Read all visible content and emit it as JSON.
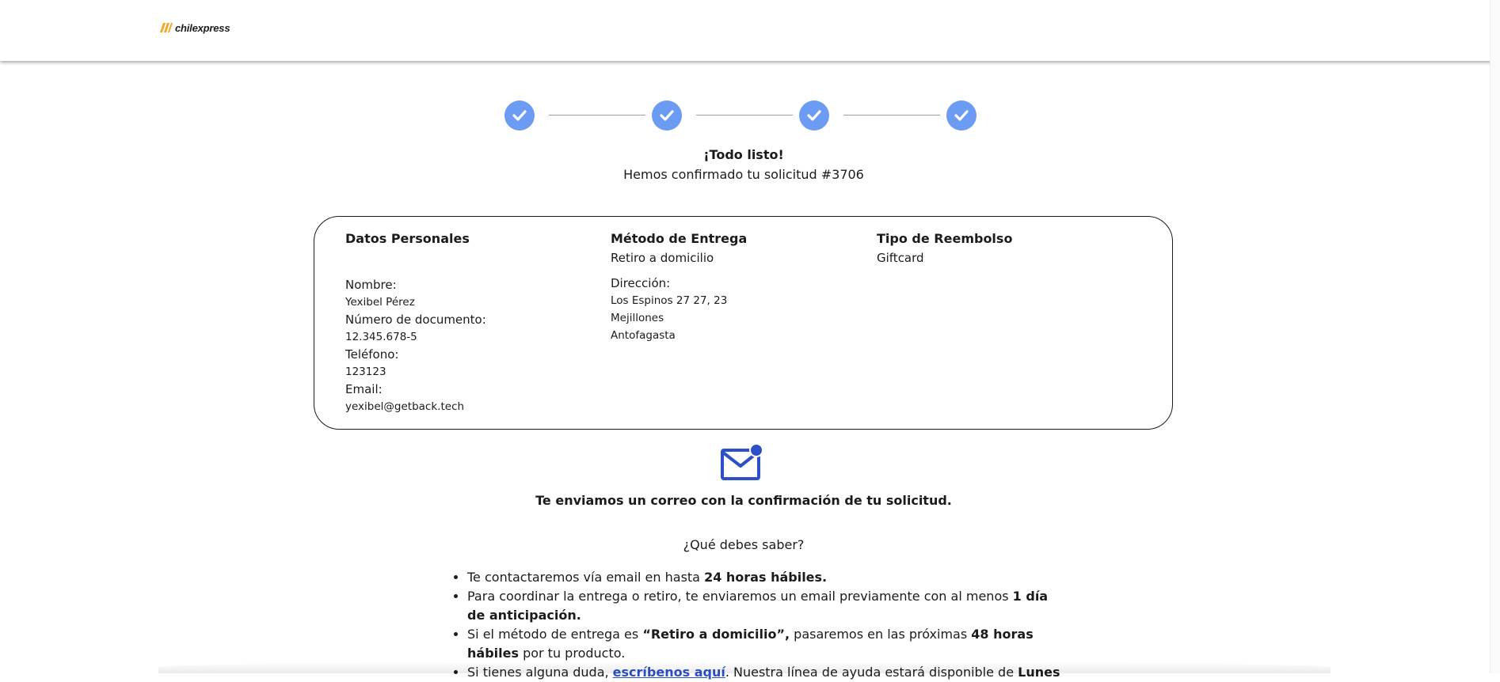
{
  "header": {
    "logo_text": "chilexpress"
  },
  "steps": [
    {
      "state": "completed"
    },
    {
      "state": "completed"
    },
    {
      "state": "completed"
    },
    {
      "state": "completed"
    }
  ],
  "confirmation": {
    "title": "¡Todo listo!",
    "subtitle": "Hemos confirmado tu solicitud #3706"
  },
  "summary": {
    "personal": {
      "heading": "Datos Personales",
      "name_label": "Nombre:",
      "name_value": "Yexibel Pérez",
      "doc_label": "Número de documento:",
      "doc_value": "12.345.678-5",
      "phone_label": "Teléfono:",
      "phone_value": "123123",
      "email_label": "Email:",
      "email_value": "yexibel@getback.tech"
    },
    "delivery": {
      "heading": "Método de Entrega",
      "method": "Retiro a domicilio",
      "address_label": "Dirección:",
      "address_line1": "Los Espinos 27 27, 23",
      "address_line2": "Mejillones",
      "address_line3": "Antofagasta"
    },
    "refund": {
      "heading": "Tipo de Reembolso",
      "type": "Giftcard"
    }
  },
  "email_notice": "Te enviamos un correo con la confirmación de tu solicitud.",
  "info": {
    "title": "¿Qué debes saber?",
    "b1_text": "Te contactaremos vía email en hasta ",
    "b1_bold": "24 horas hábiles.",
    "b2_text": "Para coordinar la entrega o retiro, te enviaremos un email previamente con al menos ",
    "b2_bold": "1 día de anticipación.",
    "b3_text1": "Si el método de entrega es ",
    "b3_bold1": "“Retiro a domicilio”,",
    "b3_text2": " pasaremos en las próximas ",
    "b3_bold2": "48 horas hábiles",
    "b3_text3": " por tu producto.",
    "b4_text1": "Si tienes alguna duda, ",
    "b4_link": "escríbenos aquí",
    "b4_text2": ". Nuestra línea de ayuda estará disponible de ",
    "b4_bold": "Lunes"
  },
  "colors": {
    "step_complete": "#6b9bf2",
    "mail_icon": "#2b50c8",
    "link": "#2b50c8"
  }
}
